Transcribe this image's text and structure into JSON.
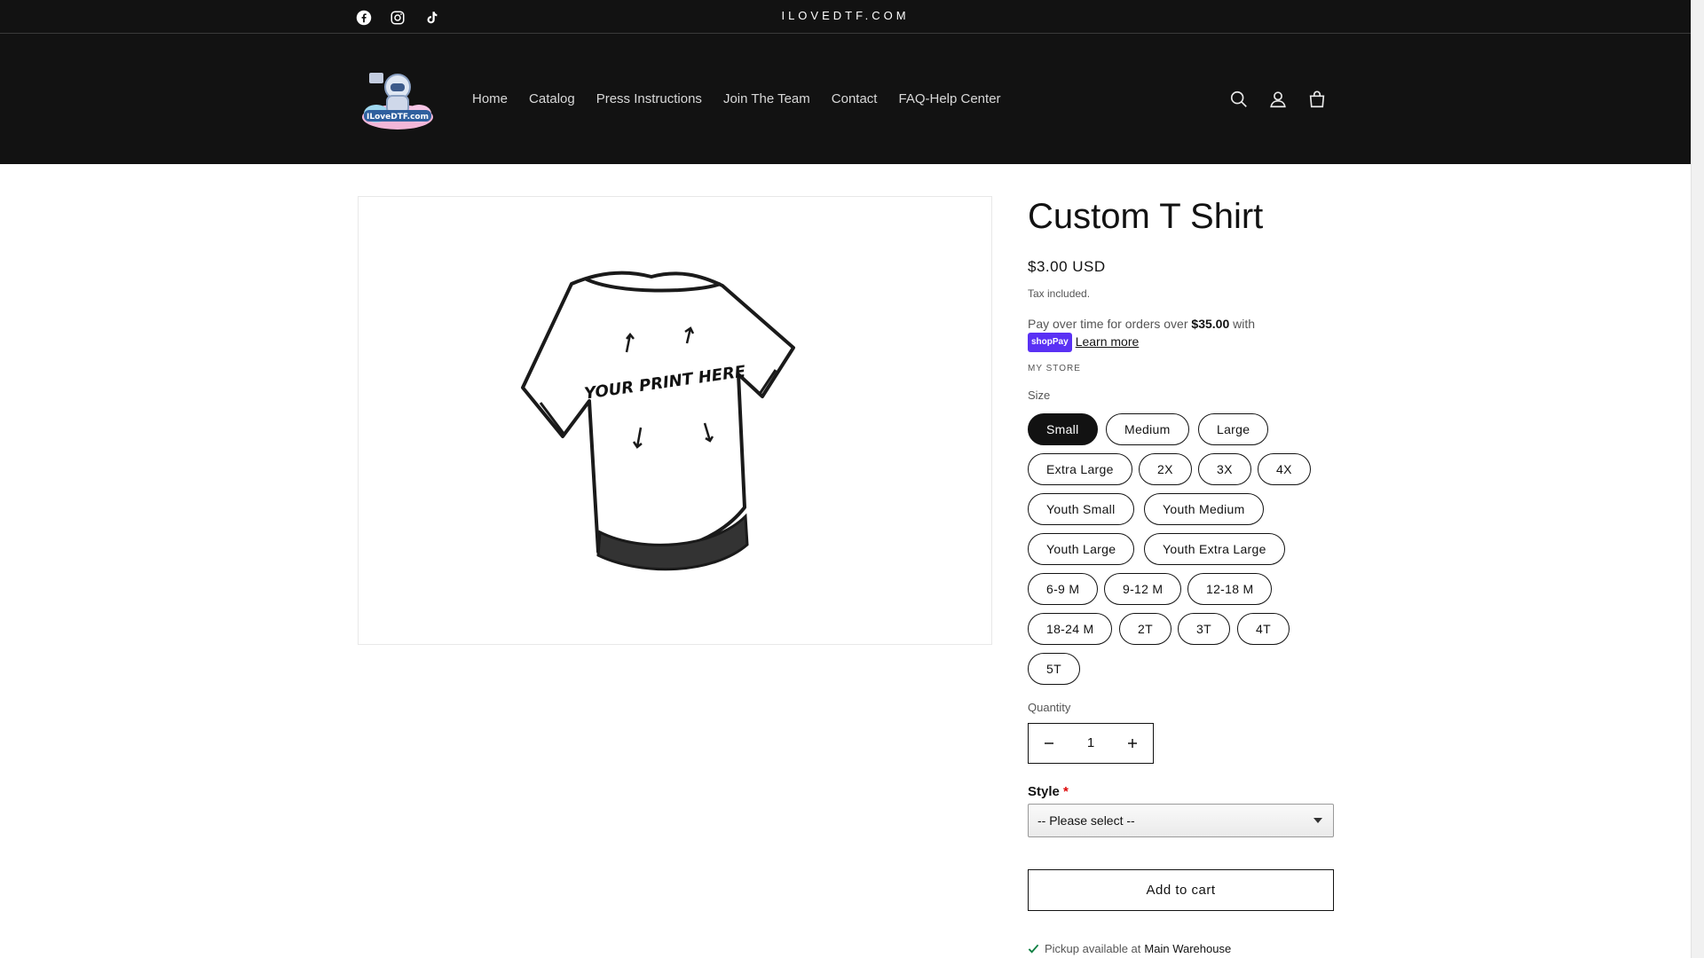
{
  "announcement": {
    "text": "ILOVEDTF.COM",
    "social_icons": [
      "facebook-icon",
      "instagram-icon",
      "tiktok-icon"
    ]
  },
  "header": {
    "logo_alt": "ILoveDTF.com",
    "nav": [
      "Home",
      "Catalog",
      "Press Instructions",
      "Join The Team",
      "Contact",
      "FAQ-Help Center"
    ],
    "icons": [
      "search-icon",
      "account-icon",
      "cart-icon"
    ]
  },
  "product": {
    "image_text": "YOUR PRINT HERE",
    "title": "Custom T Shirt",
    "price": "$3.00 USD",
    "tax_note": "Tax included.",
    "installments_prefix": "Pay over time for orders over ",
    "installments_amount": "$35.00",
    "installments_suffix": " with",
    "shop_pay": "shopPay",
    "learn_more": "Learn more",
    "vendor": "MY STORE",
    "size_label": "Size",
    "sizes": [
      "Small",
      "Medium",
      "Large",
      "Extra Large",
      "2X",
      "3X",
      "4X",
      "Youth Small",
      "Youth Medium",
      "Youth Large",
      "Youth Extra Large",
      "6-9 M",
      "9-12 M",
      "12-18 M",
      "18-24 M",
      "2T",
      "3T",
      "4T",
      "5T"
    ],
    "selected_size": "Small",
    "quantity_label": "Quantity",
    "quantity": "1",
    "style_label": "Style",
    "style_required": "*",
    "style_value": "-- Please select --",
    "add_to_cart": "Add to cart",
    "pickup_prefix": "Pickup available at",
    "pickup_location": "Main Warehouse"
  },
  "colors": {
    "header_bg": "#121212",
    "text": "#121212",
    "shop_pay": "#5a31f4",
    "pickup_check": "#108043"
  }
}
